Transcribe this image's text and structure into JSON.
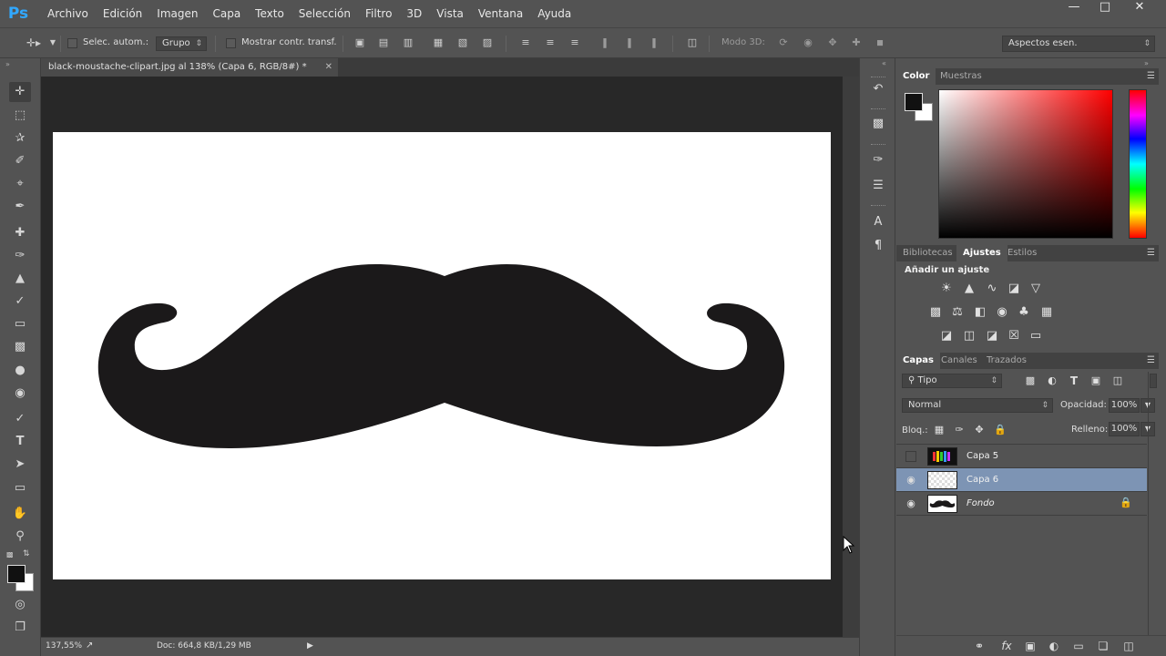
{
  "app": {
    "logo": "Ps"
  },
  "menu": [
    "Archivo",
    "Edición",
    "Imagen",
    "Capa",
    "Texto",
    "Selección",
    "Filtro",
    "3D",
    "Vista",
    "Ventana",
    "Ayuda"
  ],
  "options": {
    "auto_select_label": "Selec. autom.:",
    "auto_select_value": "Grupo",
    "show_transform_label": "Mostrar contr. transf.",
    "mode3d_label": "Modo 3D:",
    "workspace": "Aspectos esen."
  },
  "document": {
    "tab_title": "black-moustache-clipart.jpg al 138% (Capa 6, RGB/8#) *",
    "zoom": "137,55%",
    "doc_info": "Doc: 664,8 KB/1,29 MB"
  },
  "colors": {
    "foreground": "#111111",
    "background": "#ffffff",
    "moustache": "#1b191a",
    "selected_layer": "#7d94b4"
  },
  "panels": {
    "color_tabs": [
      "Color",
      "Muestras"
    ],
    "adjust_tabs": [
      "Bibliotecas",
      "Ajustes",
      "Estilos"
    ],
    "adjust_heading": "Añadir un ajuste",
    "layers_tabs": [
      "Capas",
      "Canales",
      "Trazados"
    ],
    "filter_kind": "Tipo",
    "blend_mode": "Normal",
    "opacity_label": "Opacidad:",
    "opacity_value": "100%",
    "lock_label": "Bloq.:",
    "fill_label": "Relleno:",
    "fill_value": "100%",
    "layers": [
      {
        "name": "Capa 5",
        "visible": false,
        "selected": false
      },
      {
        "name": "Capa 6",
        "visible": true,
        "selected": true
      },
      {
        "name": "Fondo",
        "visible": true,
        "selected": false,
        "locked": true
      }
    ]
  }
}
